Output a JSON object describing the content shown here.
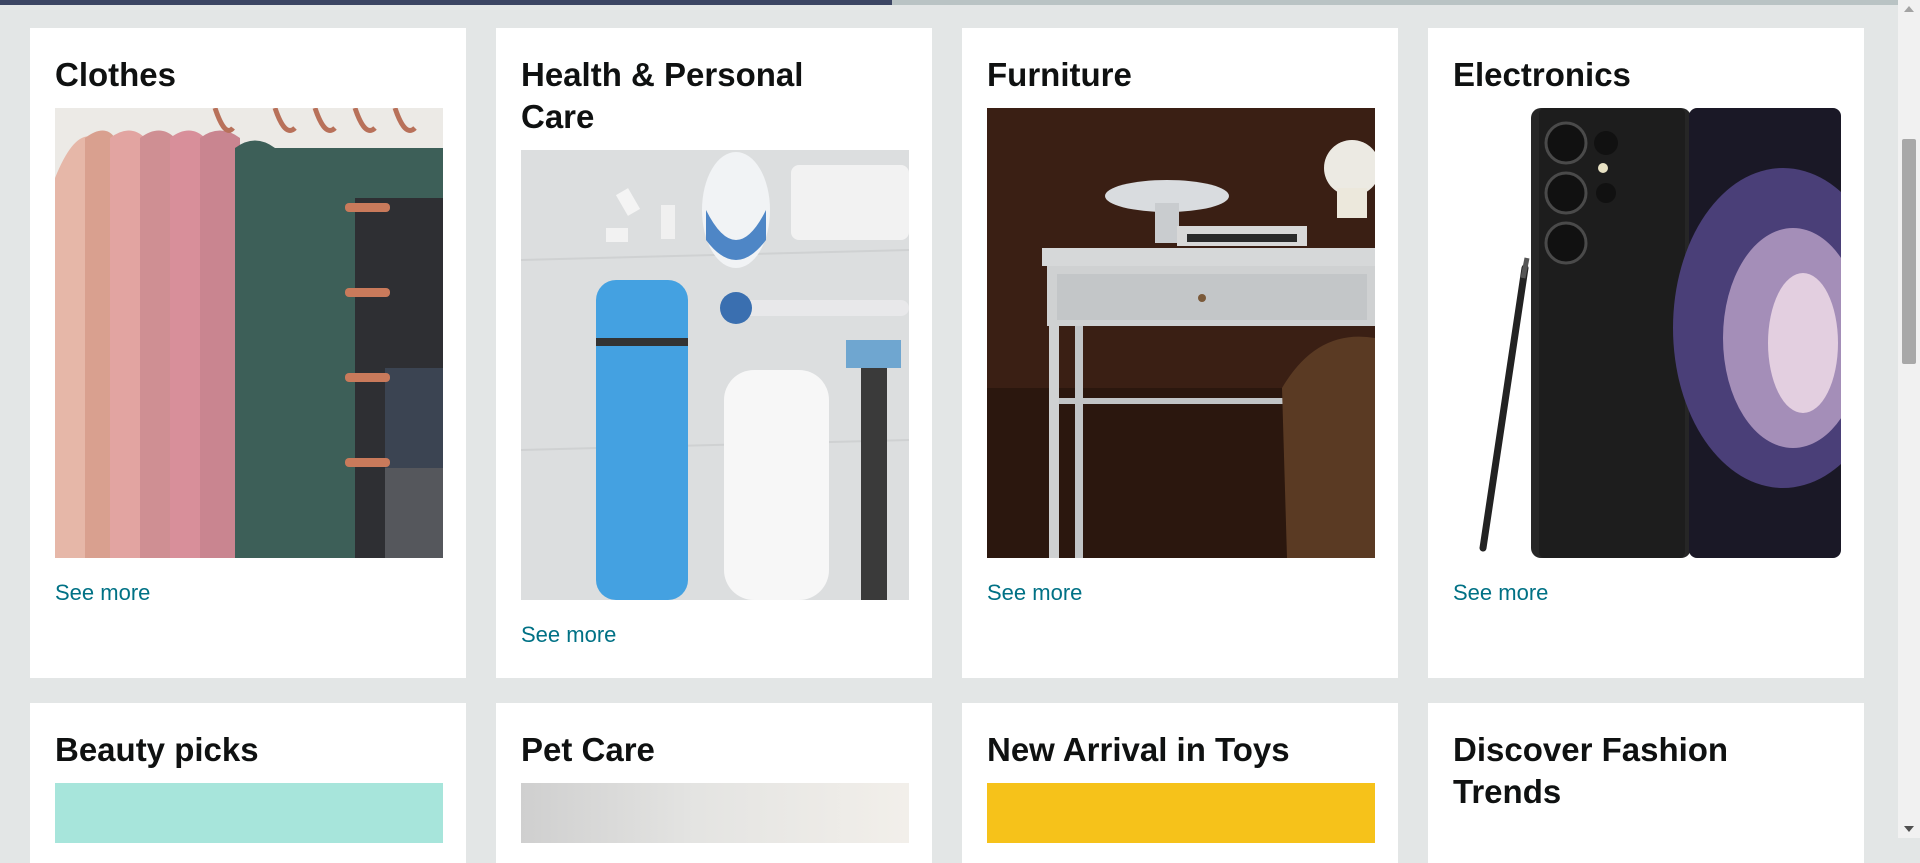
{
  "load_progress": 0.47,
  "scroll": {
    "thumb_fraction": 0.28,
    "position_fraction": 0.21
  },
  "accent_color": "#007185",
  "cards": [
    {
      "title": "Clothes",
      "link": "See more",
      "image": "folded-towels-on-rack"
    },
    {
      "title": "Health & Personal Care",
      "link": "See more",
      "image": "toiletries-flatlay"
    },
    {
      "title": "Furniture",
      "link": "See more",
      "image": "white-desk-with-bowl"
    },
    {
      "title": "Electronics",
      "link": "See more",
      "image": "black-smartphone-with-stylus"
    },
    {
      "title": "Beauty picks",
      "image": "teal-product-backdrop"
    },
    {
      "title": "Pet Care",
      "image": "pet-care-photo"
    },
    {
      "title": "New Arrival in Toys",
      "image": "yellow-toy-backdrop"
    },
    {
      "title": "Discover Fashion Trends"
    }
  ]
}
